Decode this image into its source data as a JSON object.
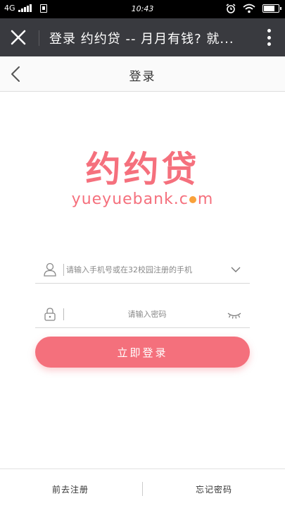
{
  "status_bar": {
    "network": "4G",
    "time": "10:43",
    "battery_level": 0.75
  },
  "webview": {
    "title": "登录 约约贷 -- 月月有钱? 就..."
  },
  "header": {
    "title": "登录"
  },
  "logo": {
    "cn": "约约贷",
    "en_a": "yueyuebank.c",
    "en_b": "m"
  },
  "form": {
    "phone_placeholder": "请输入手机号或在32校园注册的手机",
    "password_placeholder": "请输入密码",
    "login_label": "立即登录"
  },
  "footer": {
    "register_label": "前去注册",
    "forgot_label": "忘记密码"
  },
  "colors": {
    "brand_pink": "#f4707c",
    "logo_dot": "#f9a13a",
    "webview_bar": "#393a3f"
  }
}
